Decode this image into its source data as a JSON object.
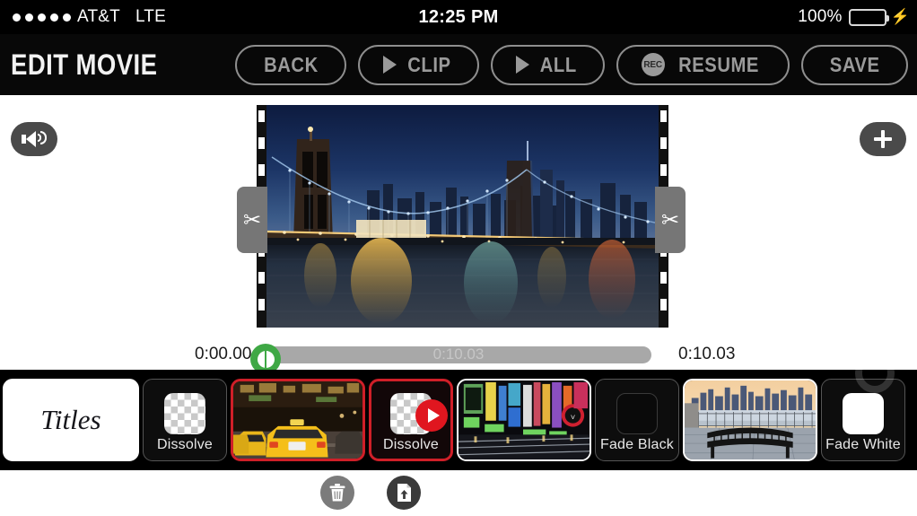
{
  "statusbar": {
    "signal_dots": 5,
    "carrier": "AT&T",
    "network": "LTE",
    "time": "12:25 PM",
    "battery_percent": "100%",
    "battery_color": "#4CD662",
    "charging": true
  },
  "toolbar": {
    "title": "EDIT MOVIE",
    "buttons": [
      {
        "id": "back",
        "label": "BACK",
        "icon": "none"
      },
      {
        "id": "clip",
        "label": "CLIP",
        "icon": "play-triangle-icon"
      },
      {
        "id": "all",
        "label": "ALL",
        "icon": "play-triangle-icon"
      },
      {
        "id": "resume",
        "label": "RESUME",
        "icon": "rec-badge-icon",
        "badge_text": "REC"
      },
      {
        "id": "save",
        "label": "SAVE",
        "icon": "none"
      }
    ]
  },
  "stage": {
    "audio_button": {
      "icon": "speaker-icon",
      "label": ""
    },
    "add_button": {
      "icon": "plus-icon",
      "label": ""
    },
    "trim_left": {
      "icon": "scissors-icon",
      "glyph": "✂"
    },
    "trim_right": {
      "icon": "scissors-icon",
      "glyph": "✂"
    },
    "preview": {
      "description": "Brooklyn Bridge at dusk with Manhattan skyline and water reflections",
      "sprocket_count": 8
    }
  },
  "scrubber": {
    "start_time": "0:00.00",
    "end_time": "0:10.03",
    "track_label": "0:10.03",
    "playhead_position_percent": 0,
    "playhead_color": "#3FA845"
  },
  "filmstrip": {
    "items": [
      {
        "id": "titles",
        "type": "titles",
        "label": "Titles",
        "selected": false,
        "has_play_badge": false
      },
      {
        "id": "dissolve-1",
        "type": "transition",
        "label": "Dissolve",
        "selected": false,
        "has_play_badge": false,
        "swatch": "checker"
      },
      {
        "id": "clip-taxis",
        "type": "clip",
        "label": "",
        "selected": true,
        "has_play_badge": false,
        "thumb": "nyc-yellow-taxis"
      },
      {
        "id": "dissolve-2",
        "type": "transition",
        "label": "Dissolve",
        "selected": true,
        "has_play_badge": true,
        "swatch": "checker"
      },
      {
        "id": "clip-neon",
        "type": "clip",
        "label": "",
        "selected": false,
        "has_play_badge": false,
        "thumb": "times-square-neon"
      },
      {
        "id": "fade-black",
        "type": "transition",
        "label": "Fade Black",
        "selected": false,
        "has_play_badge": false,
        "swatch": "black"
      },
      {
        "id": "clip-bench",
        "type": "clip",
        "label": "",
        "selected": false,
        "has_play_badge": false,
        "thumb": "bench-skyline-dusk"
      },
      {
        "id": "fade-white",
        "type": "transition",
        "label": "Fade White",
        "selected": false,
        "has_play_badge": false,
        "swatch": "white"
      }
    ]
  },
  "bottombar": {
    "delete_button": {
      "icon": "trash-icon",
      "label": ""
    },
    "export_button": {
      "icon": "export-upload-icon",
      "label": ""
    }
  },
  "colors": {
    "accent_green": "#3FA845",
    "selection_red": "#cf1f28",
    "toolbar_bg": "#080808",
    "strip_bg": "#000000",
    "page_bg": "#ffffff"
  }
}
